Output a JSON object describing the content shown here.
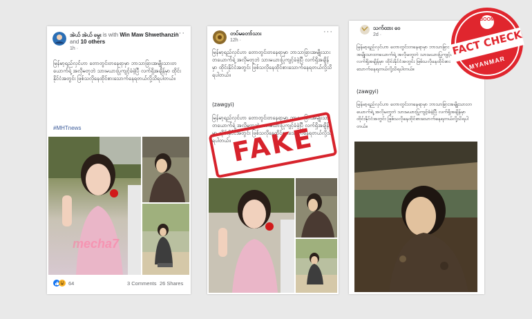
{
  "post1": {
    "author": "အဲယ် အဲယ် မွေး",
    "with_text": "is with",
    "tagged_name": "Win Maw Shwethanzin",
    "and_text": "and",
    "others": "10 others",
    "time": "1h ·",
    "body": "မြန်မာ့ရည်လှင်ဟာ တောတွင်းတနေရာမှာ ဘာသာခြားအမျိုးသားတယောက်ရဲ့ အလိုမတူဘဲ သားမယားပြုကျင့်ခံခဲ့ပြီ လက်ရှိအချိန်မှာ ထိုင်းနိုင်ငံအတွင်း ဖြစ်သလိုနေထိုင်စားသောက်နေရတယ်လို့သိရပါတယ်။",
    "hashtag": "#MHTnews",
    "reaction_count": "64",
    "comments": "3 Comments",
    "shares": "26 Shares",
    "watermark": "mecha7"
  },
  "post2": {
    "author": "တပ်မတော်သား",
    "time": "12h ·",
    "body_unicode": "မြန်မာ့ရည်လှင်ဟာ တောတွင်းတနေရာမှာ ဘာသာခြားအမျိုးသားတယောက်ရဲ့ အလိုမတူဘဲ သားမယားပြုကျင့်ခံခဲ့ပြီ လက်ရှိအချိန်မှာ ထိုင်းနိုင်ငံအတွင်း ဖြစ်သလိုနေထိုင်စားသောက်နေရတယ်လို့သိရပါတယ်။",
    "zawgyi_label": "(zawgyi)",
    "body_zawgyi": "မြန်မာ့ရည်လှင်ဟာ တောတွင်းတနေရာမှာ ဘာသာခြားအမျိုးသားတယောက်ရဲ့ အလိုမတူဘဲ သားမယားပြုကျင့်ခံခဲ့ပြီ လက်ရှိအချိန်မှာ ထိုင်းနိုင်ငံအတွင်း ဖြစ်သလိုနေထိုင်စားသောက်နေရတယ်လို့သိရပါတယ်။"
  },
  "post3": {
    "author": "သက်ထား ဝေ",
    "time": "2d ·",
    "body_unicode": "မြန်မာ့ရည်လှင်ဟာ တောတွင်းတနေရာမှာ ဘာသာခြားအမျိုးသားတယောက်ရဲ့ အလိုမတူဘဲ သားမယားပြုကျင့်ခံခဲ့ပြီ လက်ရှိအချိန်မှာ ထိုင်းနိုင်ငံအတွင်း ဖြစ်သလိုနေထိုင်စားသောက်နေရတယ်လို့သိရပါတယ်။",
    "zawgyi_label": "(zawgyi)",
    "body_zawgyi": "မြန်မာ့ရည်လှင်ဟာ တောတွင်းတနေရာမှာ ဘာသာခြားအမျိုးသားတယောက်ရဲ့ အလိုမတူဘဲ သားမယားပြုကျင့်ခံခဲ့ပြီ လက်ရှိအချိန်မှာ ထိုင်းနိုင်ငံအတွင်း ဖြစ်သလိုနေထိုင်စားသောက်နေရတယ်လို့သိရပါတယ်။"
  },
  "stamp": {
    "text": "FAKE"
  },
  "badge": {
    "top": "BOOM",
    "main": "FACT CHECK",
    "bottom": "MYANMAR"
  },
  "colors": {
    "link": "#385898",
    "stamp_red": "#d7232c",
    "badge_red": "#e0262e",
    "muted": "#65676b"
  },
  "icons": [
    "like-icon",
    "haha-icon",
    "more-options-icon"
  ]
}
